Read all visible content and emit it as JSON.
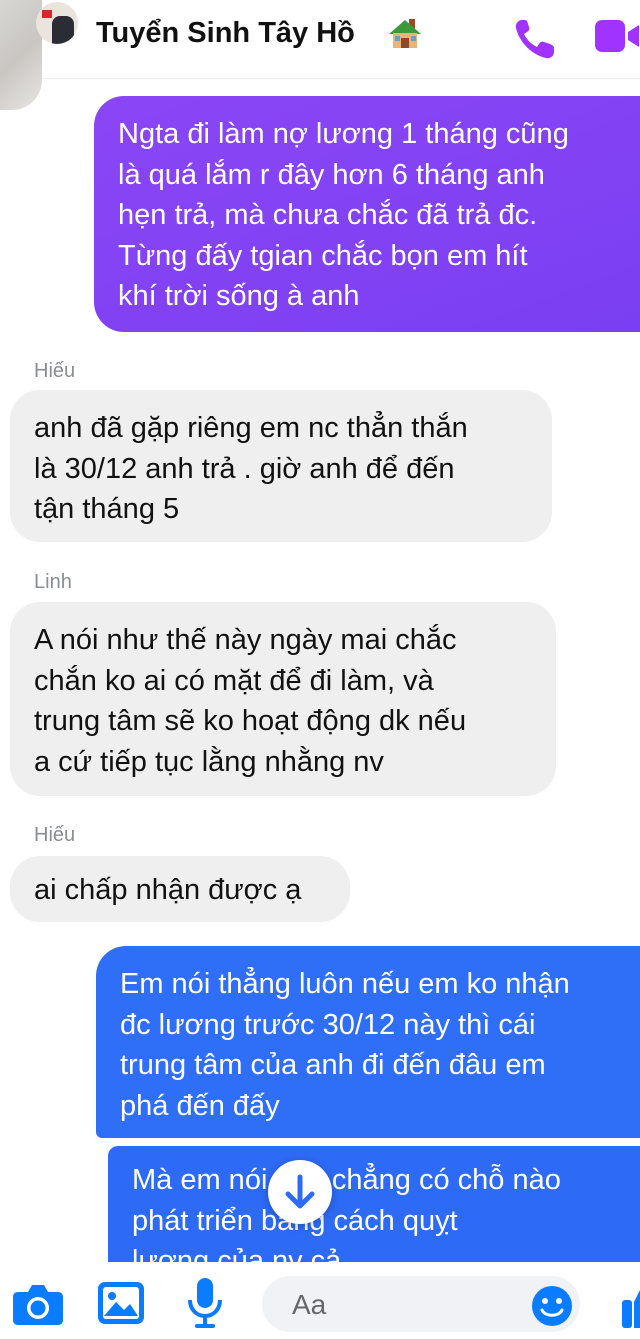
{
  "header": {
    "title": "Tuyển Sinh Tây Hồ",
    "title_icon": "house-icon",
    "actions": [
      "phone-icon",
      "video-icon"
    ],
    "accent": "#a033ff"
  },
  "messages": [
    {
      "direction": "outgoing",
      "color": "#8144f4",
      "lines": [
        "Ngta đi làm nợ lương 1 tháng cũng",
        "là quá lắm r đây hơn 6 tháng anh",
        "hẹn trả, mà chưa chắc đã trả đc.",
        "Từng đấy tgian chắc bọn em hít",
        "khí trời sống à anh"
      ]
    },
    {
      "direction": "incoming",
      "sender": "Hiếu",
      "lines": [
        "anh đã gặp riêng em nc thẳn thắn",
        "là 30/12 anh trả . giờ anh để đến",
        "tận tháng 5"
      ]
    },
    {
      "direction": "incoming",
      "sender": "Linh",
      "lines": [
        "A nói như thế này ngày mai chắc",
        "chắn ko ai có mặt để đi làm, và",
        "trung tâm sẽ ko hoạt động dk nếu",
        "a cứ tiếp tục lằng nhằng nv"
      ]
    },
    {
      "direction": "incoming",
      "sender": "Hiếu",
      "lines": [
        "ai chấp nhận được ạ"
      ]
    },
    {
      "direction": "outgoing",
      "color": "#2f6ff7",
      "lines": [
        "Em nói thẳng luôn nếu em ko nhận",
        "đc lương trước 30/12 này thì cái",
        "trung tâm của anh đi đến đâu em",
        "phá đến đấy"
      ]
    },
    {
      "direction": "outgoing",
      "color": "#2d6af5",
      "lines": [
        "Mà em nói thật chẳng có chỗ nào",
        "phát triển bằng cách quỵt",
        "lương của nv cả"
      ]
    }
  ],
  "composer": {
    "placeholder": "Aa",
    "icons": [
      "camera-icon",
      "gallery-icon",
      "microphone-icon",
      "emoji-icon",
      "like-icon"
    ]
  },
  "scroll_button_icon": "arrow-down-icon"
}
